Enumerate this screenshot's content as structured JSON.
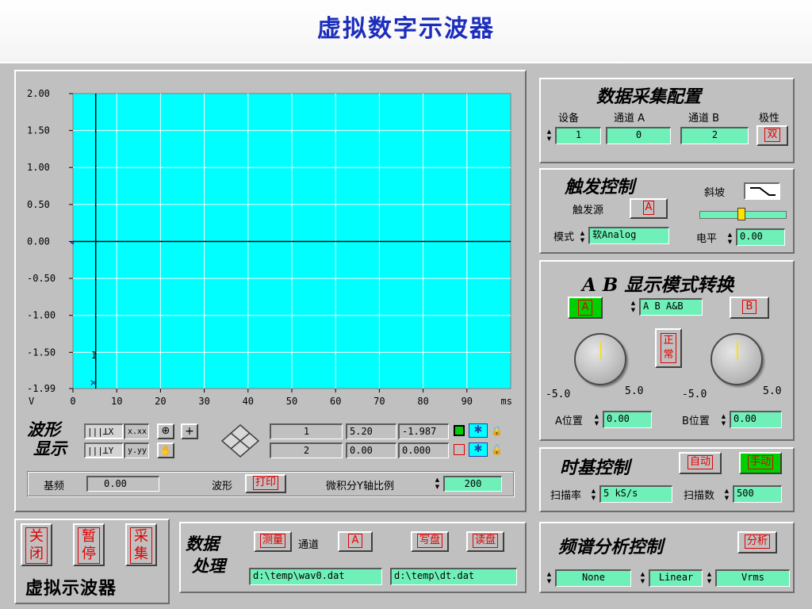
{
  "title": "虚拟数字示波器",
  "chart_data": {
    "type": "line",
    "yticks": [
      "2.00",
      "1.50",
      "1.00",
      "0.50",
      "0.00",
      "-0.50",
      "-1.00",
      "-1.50",
      "-1.99"
    ],
    "xticks": [
      "0",
      "10",
      "20",
      "30",
      "40",
      "50",
      "60",
      "70",
      "80",
      "90"
    ],
    "ylabel": "V",
    "xunit": "ms",
    "ylim": [
      -1.99,
      2.0
    ],
    "xlim": [
      0,
      100
    ],
    "grid": true,
    "background": "#00ffff",
    "series": [
      {
        "x": [
          0,
          100
        ],
        "values": [
          0.0,
          0.0
        ]
      }
    ],
    "cursor": {
      "x": 5.2,
      "label": "1"
    }
  },
  "waveform": {
    "label_1": "波形",
    "label_2": "显示",
    "x_fmt": "x.xx",
    "y_fmt": "y.yy",
    "cursor1": {
      "index": "1",
      "x": "5.20",
      "y": "-1.987"
    },
    "cursor2": {
      "index": "2",
      "x": "0.00",
      "y": "0.000"
    }
  },
  "bottom_bar": {
    "base_freq_label": "基频",
    "base_freq_value": "0.00",
    "waveform_label": "波形",
    "print_label": "打印",
    "ratio_label": "微积分Y轴比例",
    "ratio_value": "200"
  },
  "acquisition": {
    "title": "数据采集配置",
    "device_label": "设备",
    "chan_a_label": "通道 A",
    "chan_b_label": "通道 B",
    "polarity_label": "极性",
    "device_value": "1",
    "chan_a_value": "0",
    "chan_b_value": "2",
    "polarity_value": "双"
  },
  "trigger": {
    "title": "触发控制",
    "source_label": "触发源",
    "source_value": "A",
    "slope_label": "斜坡",
    "mode_label": "模式",
    "mode_value": "软Analog",
    "level_label": "电平",
    "level_value": "0.00"
  },
  "display_mode": {
    "title": "A B 显示模式转换",
    "a_label": "A",
    "mode_value": "A B A&B",
    "b_label": "B",
    "normal_label_1": "正",
    "normal_label_2": "常",
    "knob_min": "-5.0",
    "knob_max": "5.0",
    "a_pos_label": "A位置",
    "a_pos_value": "0.00",
    "b_pos_label": "B位置",
    "b_pos_value": "0.00"
  },
  "timebase": {
    "title": "时基控制",
    "auto_label": "自动",
    "manual_label": "手动",
    "rate_label": "扫描率",
    "rate_value": "5 kS/s",
    "count_label": "扫描数",
    "count_value": "500"
  },
  "controls": {
    "close_1": "关",
    "close_2": "闭",
    "pause_1": "暂",
    "pause_2": "停",
    "acquire_1": "采",
    "acquire_2": "集",
    "app_name": "虚拟示波器"
  },
  "processing": {
    "title_1": "数据",
    "title_2": "处理",
    "measure_label": "测量",
    "channel_label": "通道",
    "channel_value": "A",
    "write_label": "写盘",
    "read_label": "读盘",
    "write_path": "d:\\temp\\wav0.dat",
    "read_path": "d:\\temp\\dt.dat"
  },
  "spectrum": {
    "title": "频谱分析控制",
    "analyze_label": "分析",
    "window_value": "None",
    "scale_value": "Linear",
    "unit_value": "Vrms"
  },
  "colors": {
    "plot_bg": "#00ffff",
    "field_bg": "#6ff0b8",
    "accent_red": "#e00000",
    "active_green": "#00d000",
    "title_blue": "#1c2dbd"
  }
}
